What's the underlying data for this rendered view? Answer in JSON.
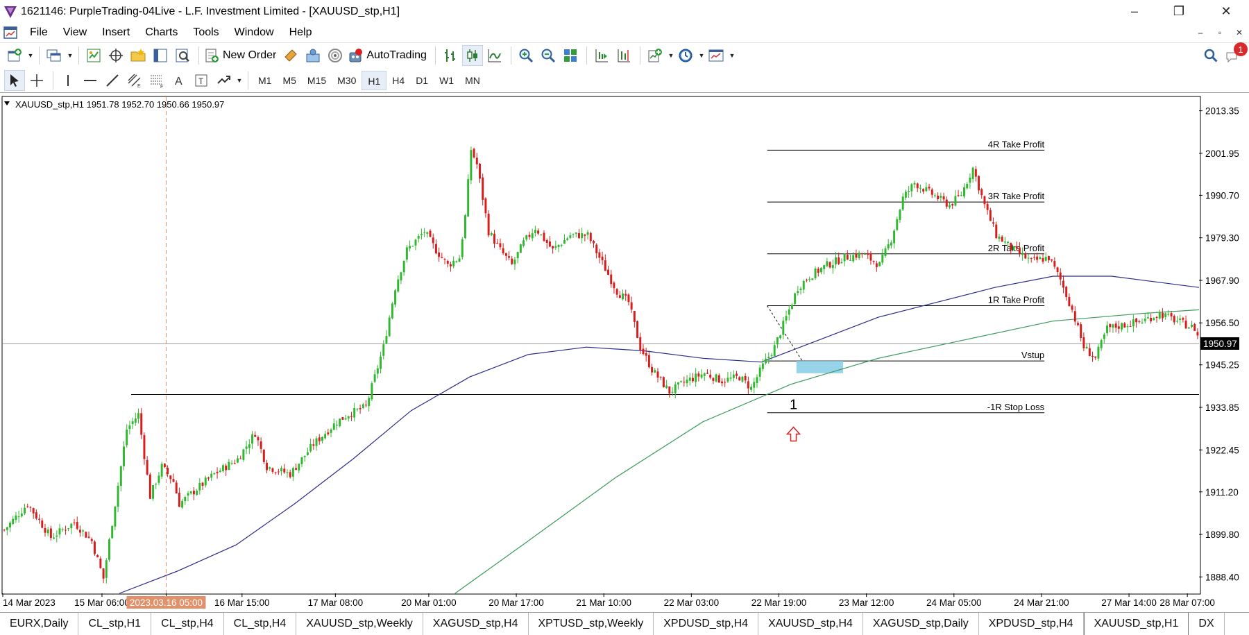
{
  "window": {
    "title": "1621146: PurpleTrading-04Live - L.F. Investment Limited - [XAUUSD_stp,H1]",
    "minimize": "–",
    "maximize": "❐",
    "close": "✕"
  },
  "menu": {
    "items": [
      "File",
      "View",
      "Insert",
      "Charts",
      "Tools",
      "Window",
      "Help"
    ],
    "mdi_minimize": "–",
    "mdi_restore": "▫",
    "mdi_close": "✕"
  },
  "toolbar": {
    "new_order": "New Order",
    "autotrading": "AutoTrading",
    "notification_count": "1"
  },
  "timeframes": {
    "items": [
      "M1",
      "M5",
      "M15",
      "M30",
      "H1",
      "H4",
      "D1",
      "W1",
      "MN"
    ],
    "active": "H1"
  },
  "chart": {
    "header": "XAUUSD_stp,H1  1951.78 1952.70 1950.66 1950.97",
    "current_price": "1950.97",
    "highlight_date": "2023.03.16 05:00",
    "entry_marker": "1",
    "colors": {
      "bull": "#2fb82f",
      "bear": "#d81b1b",
      "ma_fast": "#2a2a8c",
      "ma_slow": "#3a9a5a",
      "zone": "#8ccfe8"
    },
    "levels": [
      {
        "label": "4R Take Profit",
        "price": 2002.8
      },
      {
        "label": "3R Take Profit",
        "price": 1988.9
      },
      {
        "label": "2R Take Profit",
        "price": 1975.0
      },
      {
        "label": "1R Take Profit",
        "price": 1961.1
      },
      {
        "label": "Vstup",
        "price": 1946.3
      },
      {
        "label": "-1R Stop Loss",
        "price": 1932.4
      }
    ]
  },
  "chart_data": {
    "type": "candlestick",
    "symbol": "XAUUSD_stp",
    "timeframe": "H1",
    "y_ticks": [
      "2013.35",
      "2001.95",
      "1990.70",
      "1979.30",
      "1967.90",
      "1956.50",
      "1945.25",
      "1933.85",
      "1922.45",
      "1911.20",
      "1899.80",
      "1888.40"
    ],
    "x_ticks": [
      "14 Mar 2023",
      "15 Mar 06:00",
      "2023.03.16 05:00",
      "16 Mar 15:00",
      "17 Mar 08:00",
      "20 Mar 01:00",
      "20 Mar 17:00",
      "21 Mar 10:00",
      "22 Mar 03:00",
      "22 Mar 19:00",
      "23 Mar 12:00",
      "24 Mar 05:00",
      "24 Mar 21:00",
      "27 Mar 14:00",
      "28 Mar 07:00"
    ],
    "ylim": [
      1884.0,
      2017.0
    ],
    "horizontal_lines": [
      1950.97,
      1937.3
    ],
    "close_path": [
      [
        0,
        1901
      ],
      [
        8,
        1908
      ],
      [
        16,
        1899
      ],
      [
        24,
        1903
      ],
      [
        30,
        1898
      ],
      [
        34,
        1888
      ],
      [
        38,
        1908
      ],
      [
        42,
        1928
      ],
      [
        46,
        1932
      ],
      [
        50,
        1910
      ],
      [
        54,
        1918
      ],
      [
        58,
        1914
      ],
      [
        60,
        1908
      ],
      [
        66,
        1912
      ],
      [
        72,
        1916
      ],
      [
        80,
        1920
      ],
      [
        86,
        1927
      ],
      [
        90,
        1918
      ],
      [
        98,
        1916
      ],
      [
        106,
        1924
      ],
      [
        114,
        1930
      ],
      [
        118,
        1932
      ],
      [
        124,
        1934
      ],
      [
        130,
        1950
      ],
      [
        134,
        1966
      ],
      [
        138,
        1976
      ],
      [
        144,
        1981
      ],
      [
        148,
        1976
      ],
      [
        152,
        1972
      ],
      [
        156,
        1974
      ],
      [
        158,
        1985
      ],
      [
        160,
        2003
      ],
      [
        162,
        1999
      ],
      [
        166,
        1981
      ],
      [
        170,
        1976
      ],
      [
        174,
        1972
      ],
      [
        178,
        1978
      ],
      [
        182,
        1982
      ],
      [
        188,
        1976
      ],
      [
        194,
        1980
      ],
      [
        200,
        1980
      ],
      [
        206,
        1971
      ],
      [
        210,
        1965
      ],
      [
        214,
        1962
      ],
      [
        218,
        1950
      ],
      [
        222,
        1944
      ],
      [
        228,
        1938
      ],
      [
        234,
        1941
      ],
      [
        240,
        1943
      ],
      [
        246,
        1941
      ],
      [
        252,
        1942
      ],
      [
        256,
        1939
      ],
      [
        260,
        1945
      ],
      [
        264,
        1950
      ],
      [
        268,
        1958
      ],
      [
        272,
        1966
      ],
      [
        276,
        1969
      ],
      [
        282,
        1972
      ],
      [
        288,
        1974
      ],
      [
        294,
        1975
      ],
      [
        300,
        1972
      ],
      [
        304,
        1979
      ],
      [
        308,
        1990
      ],
      [
        312,
        1994
      ],
      [
        316,
        1992
      ],
      [
        320,
        1990
      ],
      [
        324,
        1988
      ],
      [
        328,
        1991
      ],
      [
        332,
        1998
      ],
      [
        336,
        1988
      ],
      [
        340,
        1980
      ],
      [
        346,
        1976
      ],
      [
        352,
        1973
      ],
      [
        358,
        1974
      ],
      [
        362,
        1968
      ],
      [
        366,
        1960
      ],
      [
        370,
        1950
      ],
      [
        374,
        1947
      ],
      [
        378,
        1955
      ],
      [
        384,
        1956
      ],
      [
        390,
        1957
      ],
      [
        396,
        1959
      ],
      [
        402,
        1957
      ],
      [
        408,
        1955
      ],
      [
        410,
        1951
      ]
    ],
    "ma_fast_path": [
      [
        40,
        1884
      ],
      [
        60,
        1890
      ],
      [
        80,
        1897
      ],
      [
        100,
        1908
      ],
      [
        120,
        1920
      ],
      [
        140,
        1933
      ],
      [
        160,
        1942
      ],
      [
        180,
        1948
      ],
      [
        200,
        1950
      ],
      [
        220,
        1949
      ],
      [
        240,
        1947
      ],
      [
        260,
        1946
      ],
      [
        280,
        1952
      ],
      [
        300,
        1958
      ],
      [
        320,
        1962
      ],
      [
        340,
        1966
      ],
      [
        360,
        1969
      ],
      [
        380,
        1969
      ],
      [
        400,
        1967
      ],
      [
        410,
        1966
      ]
    ],
    "ma_slow_path": [
      [
        155,
        1884
      ],
      [
        180,
        1898
      ],
      [
        210,
        1915
      ],
      [
        240,
        1930
      ],
      [
        270,
        1940
      ],
      [
        300,
        1947
      ],
      [
        330,
        1952
      ],
      [
        360,
        1957
      ],
      [
        390,
        1959
      ],
      [
        410,
        1960
      ]
    ]
  },
  "tabs": {
    "items": [
      "EURX,Daily",
      "CL_stp,H1",
      "CL_stp,H4",
      "CL_stp,H4",
      "XAUUSD_stp,Weekly",
      "XAGUSD_stp,H4",
      "XPTUSD_stp,Weekly",
      "XPDUSD_stp,H4",
      "XAUUSD_stp,H4",
      "XAGUSD_stp,Daily",
      "XPDUSD_stp,H4",
      "XAUUSD_stp,H1",
      "DX"
    ],
    "active_index": 11
  }
}
